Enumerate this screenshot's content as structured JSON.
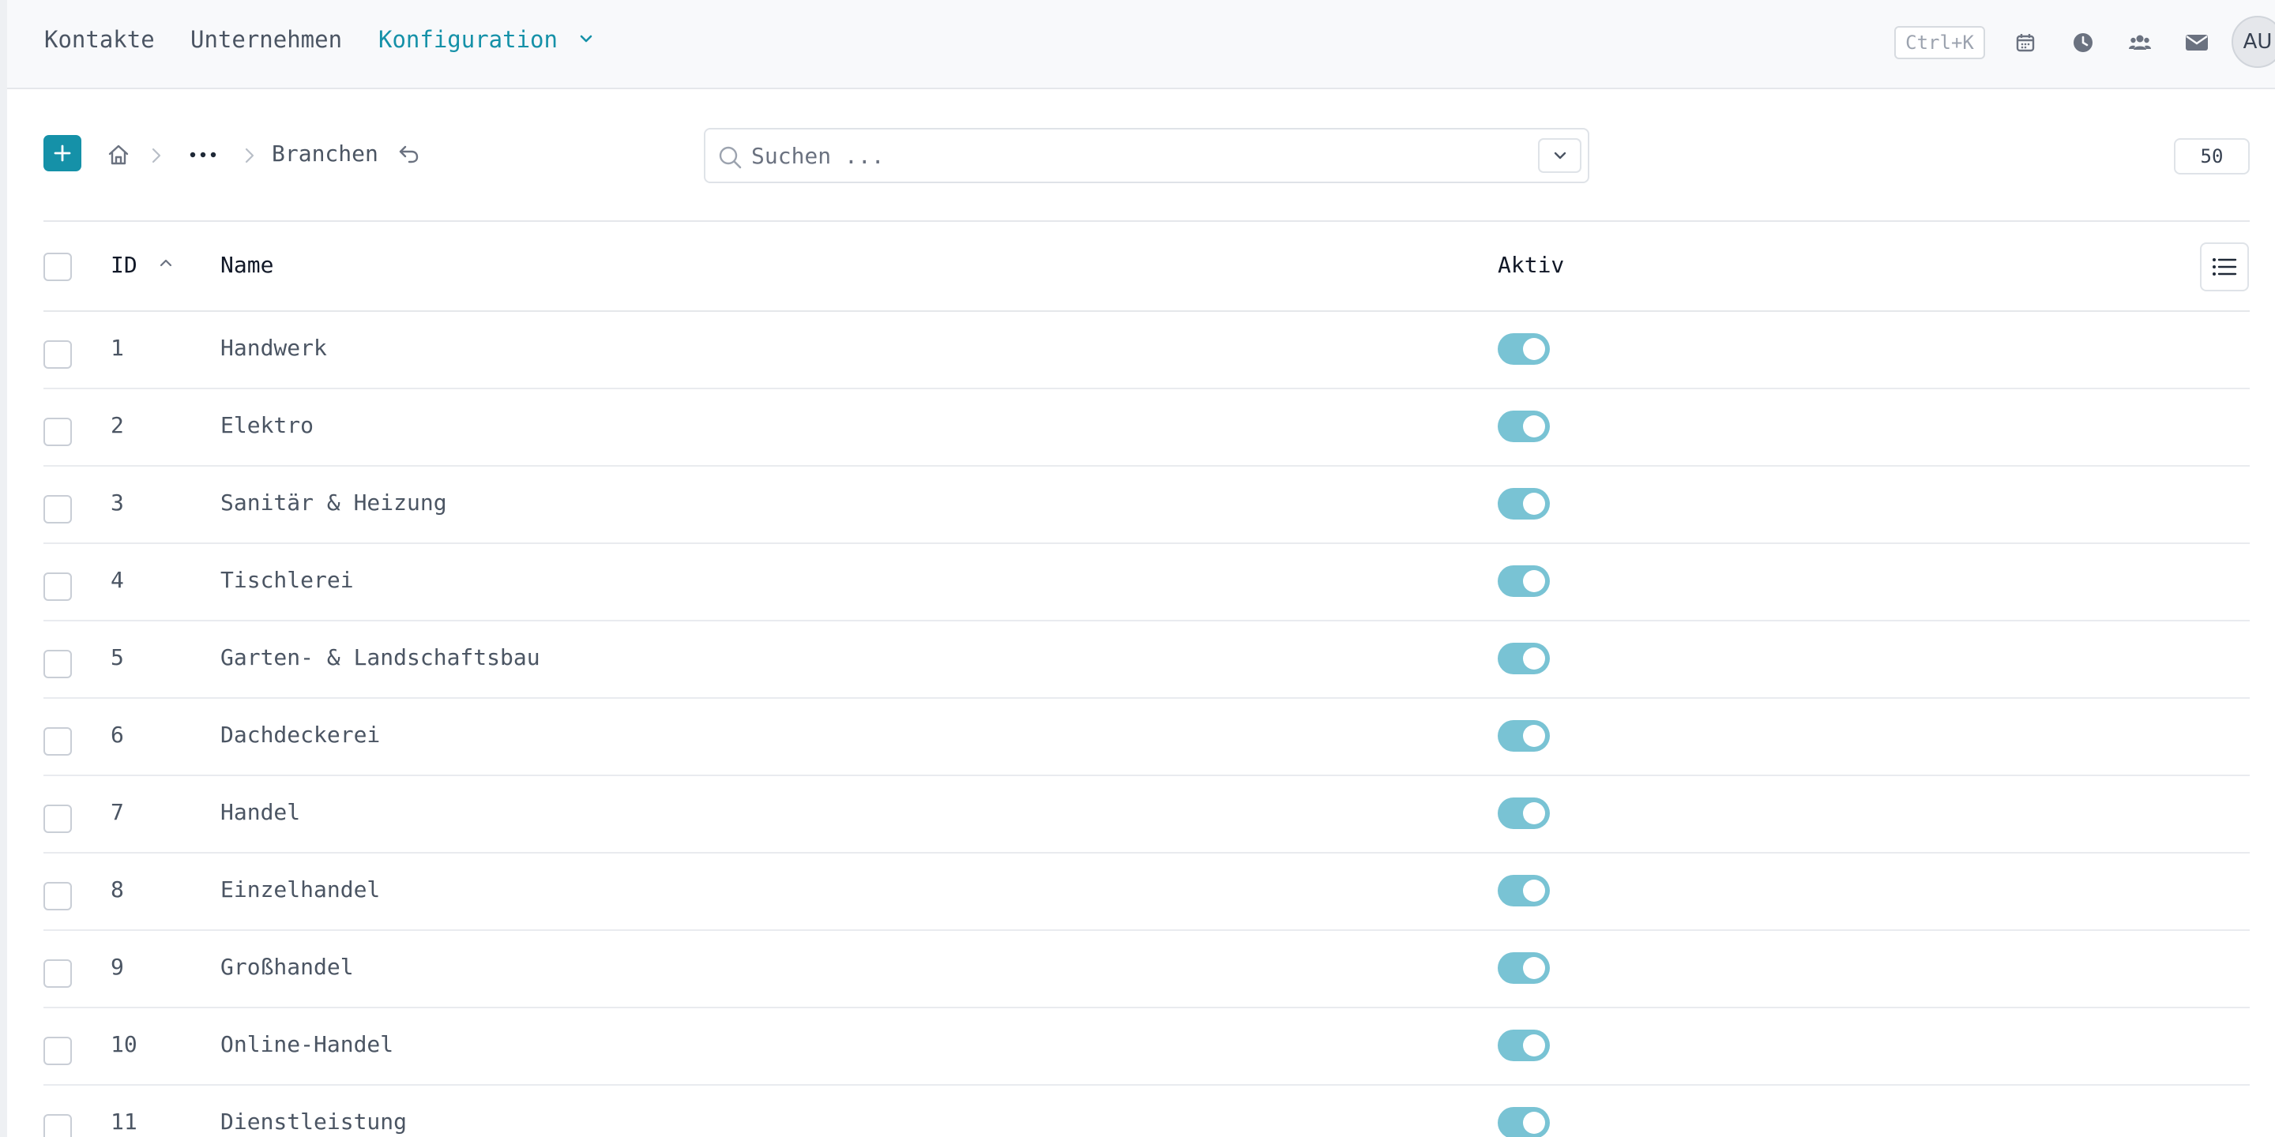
{
  "nav": {
    "items": [
      {
        "label": "Kontakte"
      },
      {
        "label": "Unternehmen"
      },
      {
        "label": "Konfiguration"
      }
    ],
    "shortcut": "Ctrl+K",
    "avatar": "AU",
    "accent_color": "#1591a8",
    "icons": [
      "calendar-icon",
      "clock-icon",
      "users-icon",
      "mail-icon"
    ]
  },
  "breadcrumb": {
    "current": "Branchen"
  },
  "search": {
    "placeholder": "Suchen ...",
    "value": ""
  },
  "pagination": {
    "page_size": "50"
  },
  "table": {
    "columns": {
      "id": "ID",
      "name": "Name",
      "active": "Aktiv"
    },
    "sort": {
      "column": "ID",
      "direction": "asc"
    },
    "toggle_color": "#79c3d4",
    "rows": [
      {
        "id": "1",
        "name": "Handwerk",
        "active": true
      },
      {
        "id": "2",
        "name": "Elektro",
        "active": true
      },
      {
        "id": "3",
        "name": "Sanitär & Heizung",
        "active": true
      },
      {
        "id": "4",
        "name": "Tischlerei",
        "active": true
      },
      {
        "id": "5",
        "name": "Garten- & Landschaftsbau",
        "active": true
      },
      {
        "id": "6",
        "name": "Dachdeckerei",
        "active": true
      },
      {
        "id": "7",
        "name": "Handel",
        "active": true
      },
      {
        "id": "8",
        "name": "Einzelhandel",
        "active": true
      },
      {
        "id": "9",
        "name": "Großhandel",
        "active": true
      },
      {
        "id": "10",
        "name": "Online-Handel",
        "active": true
      },
      {
        "id": "11",
        "name": "Dienstleistung",
        "active": true
      }
    ]
  }
}
